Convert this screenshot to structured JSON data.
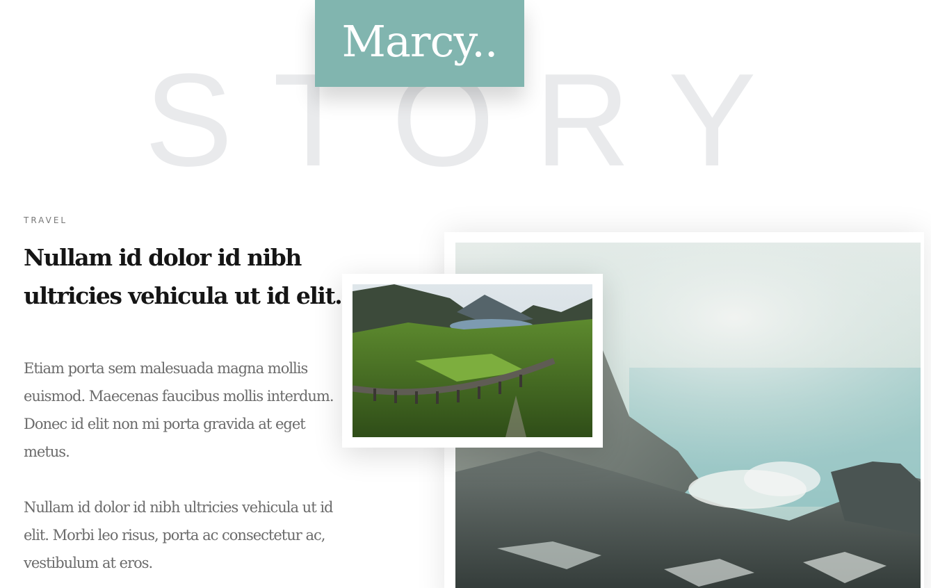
{
  "background_word": "STORY",
  "logo": {
    "text": "Marcy..",
    "color": "#81b5af"
  },
  "post": {
    "category": "TRAVEL",
    "title": "Nullam id dolor id nibh ultricies vehicula ut id elit.",
    "paragraphs": [
      "Etiam porta sem malesuada magna mollis euismod. Maecenas faucibus mollis interdum. Donec id elit non mi porta gravida at eget metus.",
      "Nullam id dolor id nibh ultricies vehicula ut id elit. Morbi leo risus, porta ac consectetur ac, vestibulum at eros."
    ]
  },
  "images": {
    "large": "volcanic crater lake photo",
    "small": "viaduct valley landscape photo"
  }
}
